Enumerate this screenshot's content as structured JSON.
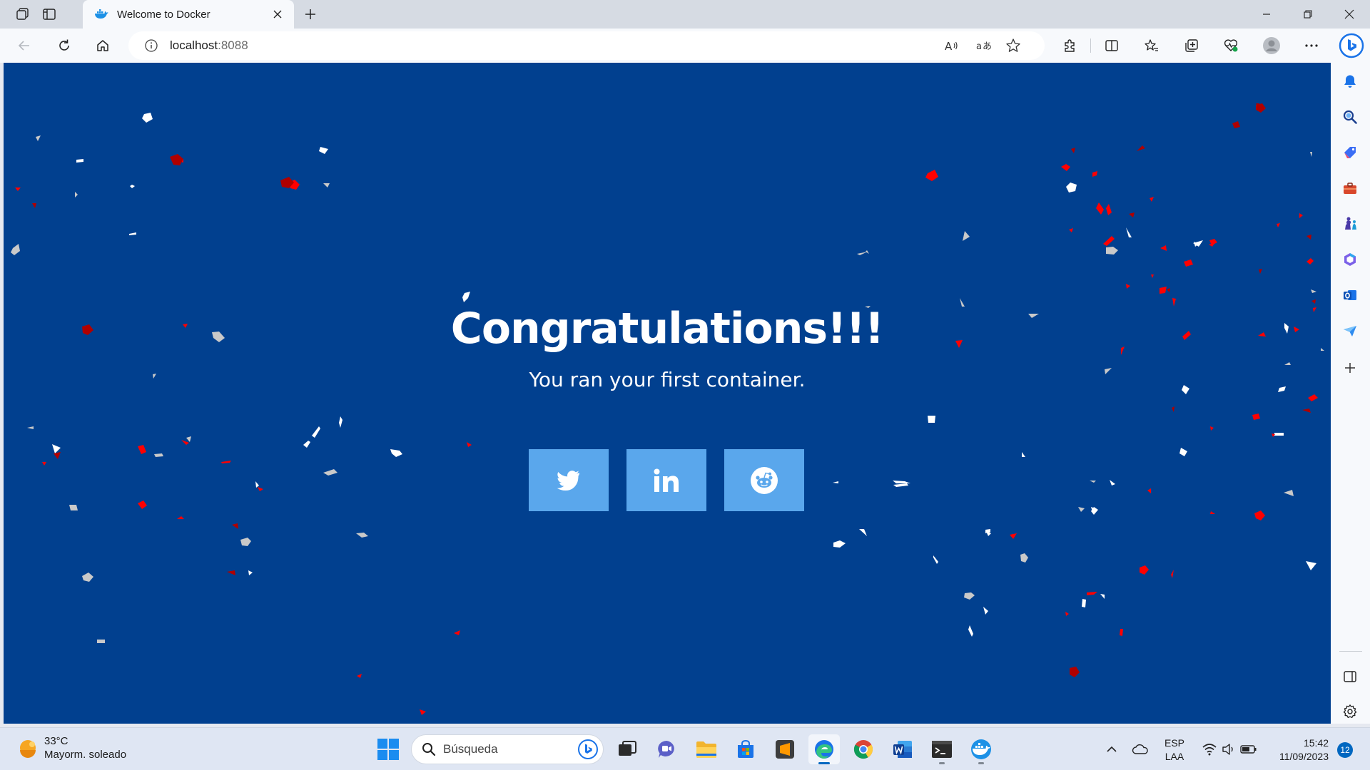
{
  "browser": {
    "tab": {
      "title": "Welcome to Docker"
    },
    "address": {
      "host": "localhost",
      "port": ":8088"
    }
  },
  "page": {
    "title": "Congratulations!!!",
    "subtitle": "You ran your first container.",
    "social_buttons": [
      "twitter-icon",
      "linkedin-icon",
      "reddit-icon"
    ],
    "background_color": "#01408f",
    "button_color": "#5aa7ec",
    "confetti_colors": [
      "#ff0000",
      "#ffffff",
      "#c9c9c9",
      "#b00000"
    ]
  },
  "sidebar": {
    "items": [
      "notification-icon",
      "search-icon",
      "shopping-tag-icon",
      "tools-icon",
      "games-icon",
      "microsoft365-icon",
      "outlook-icon",
      "drop-icon",
      "add-icon",
      "split-screen-icon",
      "settings-icon"
    ]
  },
  "taskbar": {
    "weather": {
      "temperature": "33°C",
      "condition": "Mayorm. soleado"
    },
    "search_placeholder": "Búsqueda",
    "language": {
      "code": "ESP",
      "layout": "LAA"
    },
    "time": "15:42",
    "date": "11/09/2023",
    "notifications": "12"
  }
}
